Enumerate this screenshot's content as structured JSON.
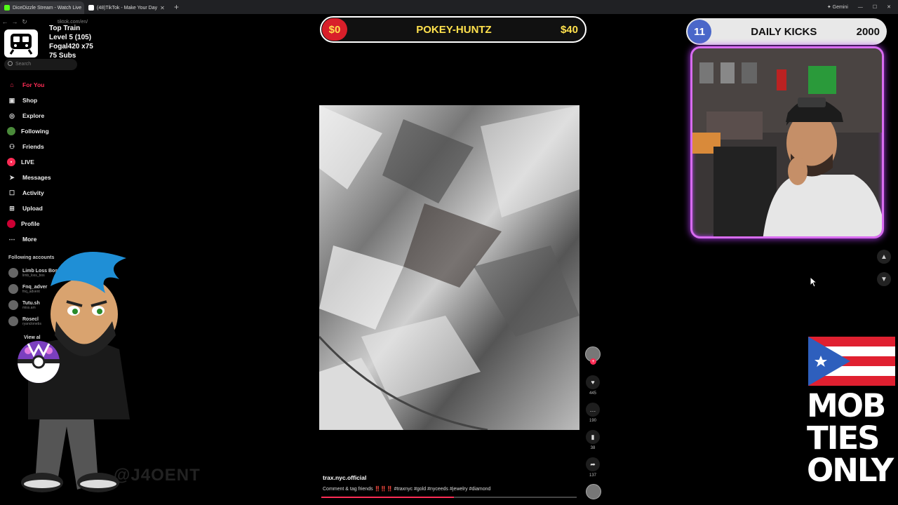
{
  "browser": {
    "tabs": [
      {
        "label": "DiceDizzle Stream - Watch Live",
        "favicon_color": "#53fc18",
        "active": true
      },
      {
        "label": "(48)TikTok - Make Your Day",
        "favicon_color": "#ffffff",
        "active": false
      }
    ],
    "new_tab": "+",
    "gemini": "Gemini",
    "url": "tiktok.com/en/"
  },
  "overlay_left": {
    "line1": "Top Train",
    "line2": "Level 5  (105)",
    "line3": "Fogal420 x75",
    "line4": "75 Subs"
  },
  "sidebar": {
    "search_placeholder": "Search",
    "items": [
      {
        "label": "For You",
        "icon": "home-icon"
      },
      {
        "label": "Shop",
        "icon": "shop-icon"
      },
      {
        "label": "Explore",
        "icon": "compass-icon"
      },
      {
        "label": "Following",
        "icon": "following-icon"
      },
      {
        "label": "Friends",
        "icon": "friends-icon"
      },
      {
        "label": "LIVE",
        "icon": "live-icon"
      },
      {
        "label": "Messages",
        "icon": "messages-icon"
      },
      {
        "label": "Activity",
        "icon": "activity-icon"
      },
      {
        "label": "Upload",
        "icon": "upload-icon"
      },
      {
        "label": "Profile",
        "icon": "profile-icon"
      },
      {
        "label": "More",
        "icon": "more-icon"
      }
    ],
    "following_title": "Following accounts",
    "accounts": [
      {
        "name": "Limb Loss Bos",
        "handle": "limb_loss_bos"
      },
      {
        "name": "Fnq_adver",
        "handle": "fnq_advent"
      },
      {
        "name": "Tutu.sh",
        "handle": "miss.am"
      },
      {
        "name": "Rosecl",
        "handle": "ryanclonebs"
      }
    ],
    "view_all": "View al"
  },
  "handle_text": "@J4OENT",
  "banner": {
    "left_amount": "$0",
    "name": "POKEY-HUNTZ",
    "right_amount": "$40"
  },
  "kicks": {
    "count": "11",
    "label": "DAILY KICKS",
    "value": "2000"
  },
  "video": {
    "username": "trax.nyc.official",
    "caption": "Comment & tag friends ‼️‼️‼️ #traxnyc #gold #nyceeds #jewelry #diamond",
    "likes": "445",
    "comments": "190",
    "saves": "38",
    "shares": "137",
    "progress": 0.52
  },
  "mob_text": [
    "MOB",
    "TIES",
    "ONLY"
  ],
  "colors": {
    "tiktok_red": "#fe2c55",
    "banner_red": "#d81f2a",
    "banner_yellow": "#ffe14d",
    "kicks_blue": "#4a67c9",
    "cam_glow": "#d86cf0"
  }
}
